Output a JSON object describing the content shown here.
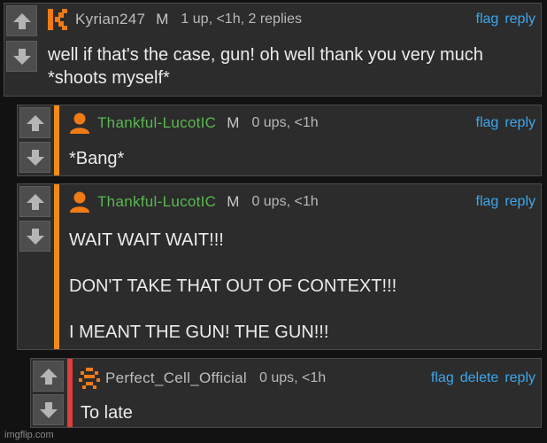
{
  "colors": {
    "link": "#3ba8ee",
    "green_name": "#59b84f",
    "bar_orange": "#f08a19",
    "bar_red": "#e23c3c",
    "avatar_orange": "#f07b16"
  },
  "icons": {
    "upvote": "arrow-up-icon",
    "downvote": "arrow-down-icon"
  },
  "comments": [
    {
      "username": "Kyrian247",
      "mod": "M",
      "meta": "1 up, <1h, 2 replies",
      "actions": [
        "flag",
        "reply"
      ],
      "text": "well if that's the case, gun! oh well thank you very much\n*shoots myself*"
    },
    {
      "username": "Thankful-LucotIC",
      "mod": "M",
      "meta": "0 ups, <1h",
      "actions": [
        "flag",
        "reply"
      ],
      "text": "*Bang*"
    },
    {
      "username": "Thankful-LucotIC",
      "mod": "M",
      "meta": "0 ups, <1h",
      "actions": [
        "flag",
        "reply"
      ],
      "text": "WAIT WAIT WAIT!!!\n\nDON'T TAKE THAT OUT OF CONTEXT!!!\n\nI MEANT THE GUN! THE GUN!!!"
    },
    {
      "username": "Perfect_Cell_Official",
      "mod": "",
      "meta": "0 ups, <1h",
      "actions": [
        "flag",
        "delete",
        "reply"
      ],
      "text": "To late"
    }
  ],
  "watermark": "imgflip.com"
}
